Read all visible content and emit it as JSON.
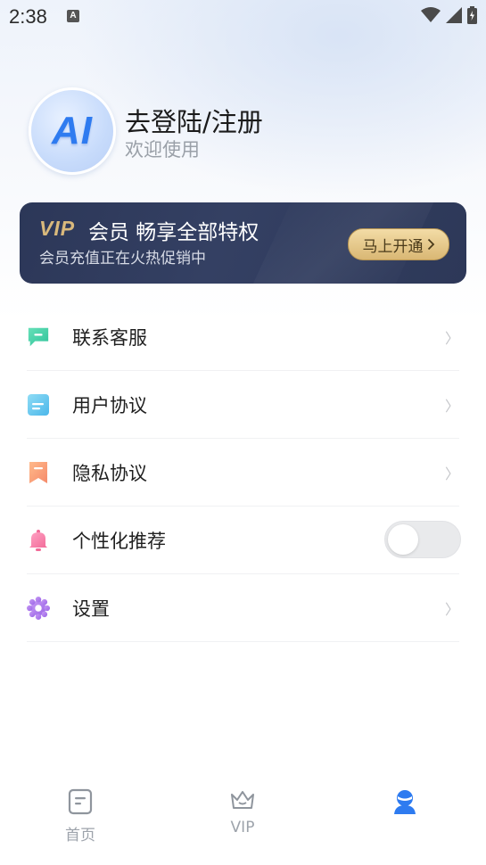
{
  "status_bar": {
    "time": "2:38",
    "notification_icon": "A"
  },
  "profile": {
    "avatar_text": "AI",
    "title": "去登陆/注册",
    "subtitle": "欢迎使用"
  },
  "vip_banner": {
    "logo": "VIP",
    "title": "会员 畅享全部特权",
    "subtitle": "会员充值正在火热促销中",
    "button_label": "马上开通"
  },
  "menu": {
    "items": [
      {
        "label": "联系客服",
        "icon": "chat-bubble-icon"
      },
      {
        "label": "用户协议",
        "icon": "document-icon"
      },
      {
        "label": "隐私协议",
        "icon": "bookmark-icon"
      },
      {
        "label": "个性化推荐",
        "icon": "bell-icon",
        "toggle": false
      },
      {
        "label": "设置",
        "icon": "gear-icon"
      }
    ]
  },
  "bottom_nav": {
    "items": [
      {
        "label": "首页",
        "icon": "home-doc-icon"
      },
      {
        "label": "VIP",
        "icon": "crown-icon"
      },
      {
        "label": "",
        "icon": "user-icon",
        "active": true
      }
    ]
  },
  "colors": {
    "accent_blue": "#2e7bf0",
    "vip_gold": "#d9b97c",
    "banner_dark": "#2c3758"
  }
}
